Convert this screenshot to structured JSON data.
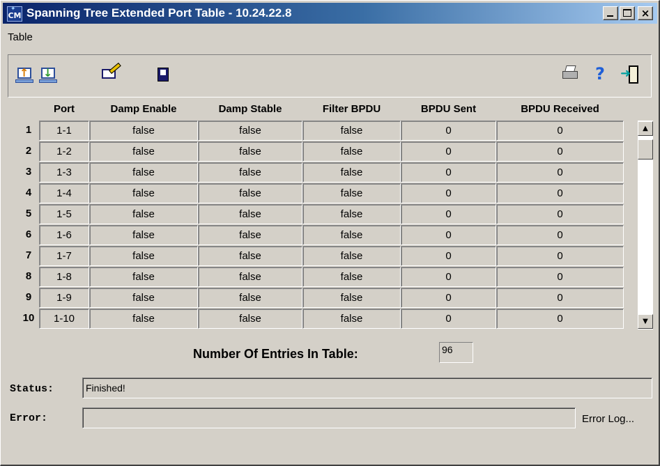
{
  "window": {
    "title": "Spanning Tree Extended Port Table - 10.24.22.8",
    "app_icon_text": "CM"
  },
  "menu": {
    "items": [
      "Table"
    ]
  },
  "toolbar": {
    "left_icons": [
      "upload-icon",
      "download-icon",
      "edit-icon",
      "save-icon"
    ],
    "right_icons": [
      "printer-icon",
      "help-icon",
      "exit-icon"
    ]
  },
  "table": {
    "columns": [
      "Port",
      "Damp Enable",
      "Damp Stable",
      "Filter BPDU",
      "BPDU Sent",
      "BPDU Received"
    ],
    "rows": [
      {
        "num": "1",
        "port": "1-1",
        "damp_enable": "false",
        "damp_stable": "false",
        "filter_bpdu": "false",
        "bpdu_sent": "0",
        "bpdu_received": "0"
      },
      {
        "num": "2",
        "port": "1-2",
        "damp_enable": "false",
        "damp_stable": "false",
        "filter_bpdu": "false",
        "bpdu_sent": "0",
        "bpdu_received": "0"
      },
      {
        "num": "3",
        "port": "1-3",
        "damp_enable": "false",
        "damp_stable": "false",
        "filter_bpdu": "false",
        "bpdu_sent": "0",
        "bpdu_received": "0"
      },
      {
        "num": "4",
        "port": "1-4",
        "damp_enable": "false",
        "damp_stable": "false",
        "filter_bpdu": "false",
        "bpdu_sent": "0",
        "bpdu_received": "0"
      },
      {
        "num": "5",
        "port": "1-5",
        "damp_enable": "false",
        "damp_stable": "false",
        "filter_bpdu": "false",
        "bpdu_sent": "0",
        "bpdu_received": "0"
      },
      {
        "num": "6",
        "port": "1-6",
        "damp_enable": "false",
        "damp_stable": "false",
        "filter_bpdu": "false",
        "bpdu_sent": "0",
        "bpdu_received": "0"
      },
      {
        "num": "7",
        "port": "1-7",
        "damp_enable": "false",
        "damp_stable": "false",
        "filter_bpdu": "false",
        "bpdu_sent": "0",
        "bpdu_received": "0"
      },
      {
        "num": "8",
        "port": "1-8",
        "damp_enable": "false",
        "damp_stable": "false",
        "filter_bpdu": "false",
        "bpdu_sent": "0",
        "bpdu_received": "0"
      },
      {
        "num": "9",
        "port": "1-9",
        "damp_enable": "false",
        "damp_stable": "false",
        "filter_bpdu": "false",
        "bpdu_sent": "0",
        "bpdu_received": "0"
      },
      {
        "num": "10",
        "port": "1-10",
        "damp_enable": "false",
        "damp_stable": "false",
        "filter_bpdu": "false",
        "bpdu_sent": "0",
        "bpdu_received": "0"
      }
    ]
  },
  "entries": {
    "label": "Number Of Entries In Table:",
    "value": "96"
  },
  "status": {
    "label": "Status:",
    "value": "Finished!"
  },
  "error": {
    "label": "Error:",
    "value": "",
    "log_button": "Error Log..."
  }
}
